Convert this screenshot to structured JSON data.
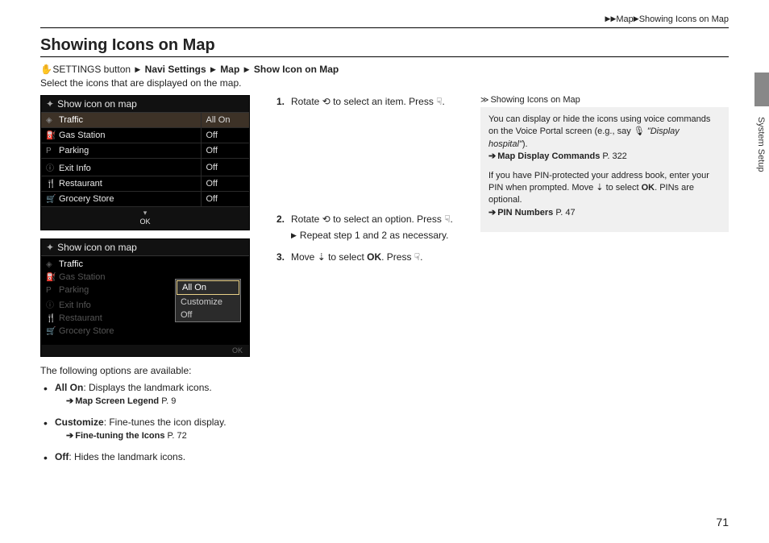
{
  "breadcrumb": {
    "seg1": "Map",
    "seg2": "Showing Icons on Map"
  },
  "title": "Showing Icons on Map",
  "side_label": "System Setup",
  "page_number": "71",
  "navpath": {
    "settings": "SETTINGS button",
    "s1": "Navi Settings",
    "s2": "Map",
    "s3": "Show Icon on Map"
  },
  "intro": "Select the icons that are displayed on the map.",
  "device1": {
    "title": "Show icon on map",
    "rows": [
      {
        "icon": "◈",
        "label": "Traffic",
        "value": "All On",
        "highlight": true
      },
      {
        "icon": "⛽",
        "label": "Gas Station",
        "value": "Off"
      },
      {
        "icon": "P",
        "label": "Parking",
        "value": "Off"
      },
      {
        "icon": "ⓘ",
        "label": "Exit Info",
        "value": "Off"
      },
      {
        "icon": "🍴",
        "label": "Restaurant",
        "value": "Off"
      },
      {
        "icon": "🛒",
        "label": "Grocery Store",
        "value": "Off"
      }
    ],
    "ok": "OK"
  },
  "device2": {
    "title": "Show icon on map",
    "rows": [
      {
        "icon": "◈",
        "label": "Traffic",
        "lit": true
      },
      {
        "icon": "⛽",
        "label": "Gas Station"
      },
      {
        "icon": "P",
        "label": "Parking"
      },
      {
        "icon": "ⓘ",
        "label": "Exit Info"
      },
      {
        "icon": "🍴",
        "label": "Restaurant"
      },
      {
        "icon": "🛒",
        "label": "Grocery Store"
      }
    ],
    "popup": [
      "All On",
      "Customize",
      "Off"
    ],
    "ok": "OK"
  },
  "steps": {
    "s1a": "Rotate ",
    "s1b": " to select an item. Press ",
    "s1c": ".",
    "s2a": "Rotate ",
    "s2b": " to select an option. Press ",
    "s2c": ".",
    "s2sub": "Repeat step 1 and 2 as necessary.",
    "s3a": "Move ",
    "s3b": " to select ",
    "s3ok": "OK",
    "s3c": ". Press ",
    "s3d": "."
  },
  "opts_intro": "The following options are available:",
  "opts": {
    "allon_label": "All On",
    "allon_desc": ": Displays the landmark icons.",
    "allon_ref": "Map Screen Legend",
    "allon_page": " P. 9",
    "custom_label": "Customize",
    "custom_desc": ": Fine-tunes the icon display.",
    "custom_ref": "Fine-tuning the Icons",
    "custom_page": " P. 72",
    "off_label": "Off",
    "off_desc": ": Hides the landmark icons."
  },
  "side": {
    "hdr": "Showing Icons on Map",
    "p1a": "You can display or hide the icons using voice commands on the Voice Portal screen (e.g., say ",
    "p1q": "\"Display hospital\"",
    "p1b": ").",
    "ref1": "Map Display Commands",
    "ref1p": " P. 322",
    "p2a": "If you have PIN-protected your address book, enter your PIN when prompted. Move ",
    "p2b": " to select ",
    "p2ok": "OK",
    "p2c": ". PINs are optional.",
    "ref2": "PIN Numbers",
    "ref2p": " P. 47"
  },
  "glyph": {
    "rotate": "�κ⟳",
    "press": "☟",
    "move": "⇩",
    "voice": "🎤"
  }
}
